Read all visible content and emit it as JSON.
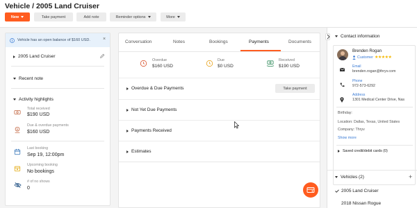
{
  "header": {
    "title": "Vehicle / 2005 Land Cruiser",
    "buttons": {
      "new": "New",
      "take_payment": "Take payment",
      "add_note": "Add note",
      "reminder_options": "Reminder options",
      "more": "More"
    }
  },
  "left": {
    "alert": "Vehicle has an open balance of $160 USD.",
    "vehicle_name": "2005 Land Cruiser",
    "recent_note": "Recent note",
    "activity_title": "Activity highlights",
    "highlights": [
      {
        "label": "Total received",
        "value": "$190 USD"
      },
      {
        "label": "Due & overdue payments",
        "value": "$160 USD"
      },
      {
        "label": "Last booking",
        "value": "Sep 19, 12:00pm"
      },
      {
        "label": "Upcoming booking",
        "value": "No bookings"
      },
      {
        "label": "# of no shows",
        "value": "0"
      }
    ]
  },
  "center": {
    "tabs": [
      "Conversation",
      "Notes",
      "Bookings",
      "Payments",
      "Documents"
    ],
    "active_tab": "Payments",
    "stats": [
      {
        "label": "Overdue",
        "value": "$160 USD"
      },
      {
        "label": "Due",
        "value": "$0 USD"
      },
      {
        "label": "Received",
        "value": "$190 USD"
      }
    ],
    "sections": [
      "Overdue & Due Payments",
      "Not Yet Due Payments",
      "Payments Received",
      "Estimates"
    ],
    "take_payment": "Take payment"
  },
  "right": {
    "contact_title": "Contact information",
    "name": "Brenden Rogan",
    "role": "Customer",
    "rating": 5,
    "email_label": "Email",
    "email": "brenden.rogan@thryv.com",
    "phone_label": "Phone",
    "phone": "972-573-6292",
    "address_label": "Address",
    "address": "1301 Medical Center Drive, Nas",
    "birthday": "Birthday:",
    "location": "Location: Dallas, Texas, United States",
    "company": "Company: Thryv",
    "show_more": "Show more",
    "saved_cards": "Saved credit/debit cards (0)",
    "vehicles_title": "Vehicles (2)",
    "vehicles": [
      "2005 Land Cruiser",
      "2018 Nissan Rogue"
    ]
  },
  "colors": {
    "accent": "#ff5c1f",
    "link": "#3a7bd5",
    "alert_bg": "#e7f1fb",
    "star": "#f5b800"
  }
}
